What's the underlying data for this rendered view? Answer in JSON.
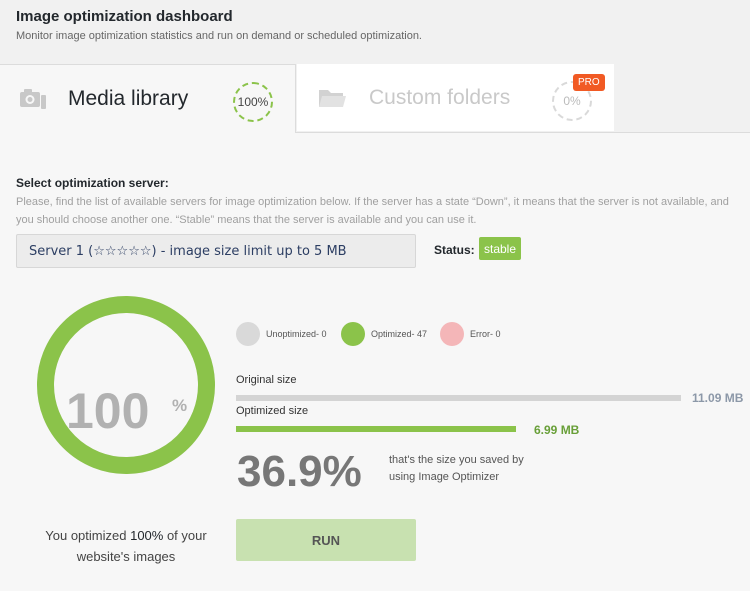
{
  "header": {
    "title": "Image optimization dashboard",
    "subtitle": "Monitor image optimization statistics and run on demand or scheduled optimization."
  },
  "tabs": [
    {
      "label": "Media library",
      "ring": "100%",
      "icon": "camera-icon",
      "active": true
    },
    {
      "label": "Custom folders",
      "ring": "0%",
      "icon": "folder-icon",
      "badge": "PRO",
      "active": false
    }
  ],
  "server": {
    "title": "Select optimization server:",
    "description": "Please, find the list of available servers for image optimization below. If the server has a state “Down”, it means that the server is not available, and you should choose another one. “Stable” means that the server is available and you can use it.",
    "selected": "Server 1 (☆☆☆☆☆) - image size limit up to 5 MB",
    "status_label": "Status:",
    "status_value": "stable"
  },
  "progress": {
    "value": "100",
    "unit": "%",
    "fraction": 1.0,
    "caption_prefix": "You optimized ",
    "caption_highlight": "100%",
    "caption_suffix": " of your website's images"
  },
  "legend": [
    {
      "label": "Unoptimized- 0",
      "color": "#d9d9d9"
    },
    {
      "label": "Optimized- 47",
      "color": "#8bc34a"
    },
    {
      "label": "Error- 0",
      "color": "#f4b6b8"
    }
  ],
  "sizes": {
    "original_label": "Original size",
    "original_value": "11.09 MB",
    "optimized_label": "Optimized size",
    "optimized_value": "6.99 MB"
  },
  "saved": {
    "percent": "36.9%",
    "text": "that's the size you saved by using Image Optimizer"
  },
  "run_label": "RUN",
  "colors": {
    "accent": "#8bc34a",
    "pro_badge": "#f15a24"
  }
}
